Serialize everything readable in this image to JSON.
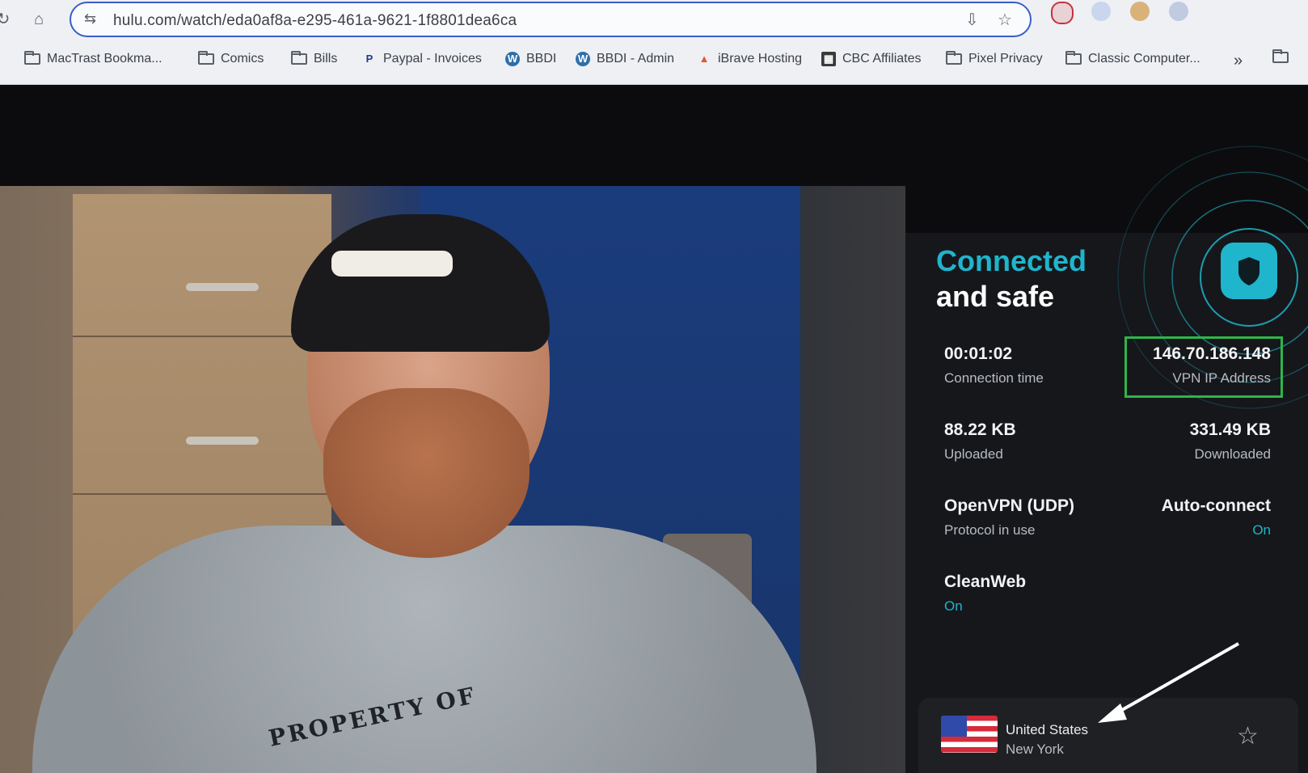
{
  "browser": {
    "url": "hulu.com/watch/eda0af8a-e295-461a-9621-1f8801dea6ca",
    "bookmarks": [
      {
        "label": "MacTrast Bookma...",
        "icon": "folder-icon"
      },
      {
        "label": "Comics",
        "icon": "folder-icon"
      },
      {
        "label": "Bills",
        "icon": "folder-icon"
      },
      {
        "label": "Paypal - Invoices",
        "icon": "paypal-icon"
      },
      {
        "label": "BBDI",
        "icon": "wordpress-icon"
      },
      {
        "label": "BBDI - Admin",
        "icon": "wordpress-icon"
      },
      {
        "label": "iBrave Hosting",
        "icon": "brave-icon"
      },
      {
        "label": "CBC Affiliates",
        "icon": "cbc-icon"
      },
      {
        "label": "Pixel Privacy",
        "icon": "folder-icon"
      },
      {
        "label": "Classic Computer...",
        "icon": "folder-icon"
      }
    ],
    "more_label": "»"
  },
  "video": {
    "shirt_text": "PROPERTY OF"
  },
  "vpn": {
    "title_line1": "Connected",
    "title_line2": "and safe",
    "connection_time": {
      "value": "00:01:02",
      "label": "Connection time"
    },
    "ip": {
      "value": "146.70.186.148",
      "label": "VPN IP Address"
    },
    "uploaded": {
      "value": "88.22 KB",
      "label": "Uploaded"
    },
    "downloaded": {
      "value": "331.49 KB",
      "label": "Downloaded"
    },
    "protocol": {
      "value": "OpenVPN (UDP)",
      "label": "Protocol in use"
    },
    "auto_connect": {
      "value": "Auto-connect",
      "status": "On"
    },
    "cleanweb": {
      "value": "CleanWeb",
      "status": "On"
    },
    "location": {
      "country": "United States",
      "city": "New York"
    },
    "accent_color": "#1fb5cc",
    "highlight_color": "#2fb54a"
  }
}
